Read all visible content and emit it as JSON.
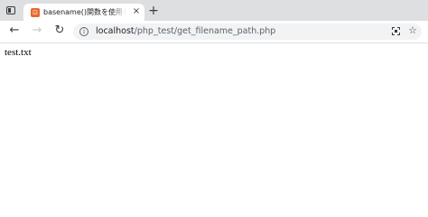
{
  "tab": {
    "title": "basename()関数を使用しパスから",
    "close_glyph": "×",
    "favicon_glyph": "⊡"
  },
  "new_tab_glyph": "+",
  "nav": {
    "back_glyph": "←",
    "forward_glyph": "→",
    "reload_glyph": "↻"
  },
  "address": {
    "info_glyph": "i",
    "host": "localhost",
    "path": "/php_test/get_filename_path.php"
  },
  "star_glyph": "☆",
  "page": {
    "text": "test.txt"
  },
  "colors": {
    "tabstrip": "#dedfe1",
    "favicon": "#e8682c",
    "omnibox": "#f1f3f4"
  }
}
